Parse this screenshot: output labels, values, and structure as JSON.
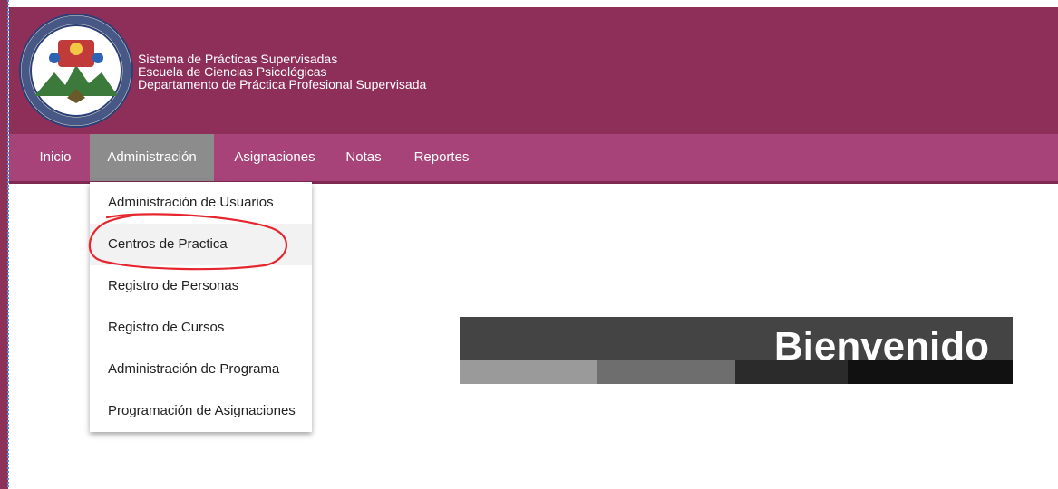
{
  "header": {
    "line1": "Sistema de Prácticas Supervisadas",
    "line2": "Escuela de Ciencias Psicológicas",
    "line3": "Departamento de Práctica Profesional Supervisada",
    "logo_icon": "university-seal-icon",
    "logo_text": "CAROLINA ACADEMIA COACTEMALENSIS INTER CAETERAS ORBIS CONSPICUA"
  },
  "nav": {
    "items": [
      {
        "label": "Inicio"
      },
      {
        "label": "Administración",
        "active": true
      },
      {
        "label": "Asignaciones"
      },
      {
        "label": "Notas"
      },
      {
        "label": "Reportes"
      }
    ]
  },
  "dropdown": {
    "items": [
      {
        "label": "Administración de Usuarios"
      },
      {
        "label": "Centros de Practica",
        "highlighted": true
      },
      {
        "label": "Registro de Personas"
      },
      {
        "label": "Registro de Cursos"
      },
      {
        "label": "Administración de Programa"
      },
      {
        "label": "Programación de Asignaciones"
      }
    ]
  },
  "banner": {
    "title": "Bienvenido"
  },
  "colors": {
    "header_bg": "#8e2f5a",
    "nav_bg": "#a8437a",
    "nav_active_bg": "#8c8c8c",
    "annotation_red": "#e5262e",
    "banner_bg": "#444444"
  }
}
